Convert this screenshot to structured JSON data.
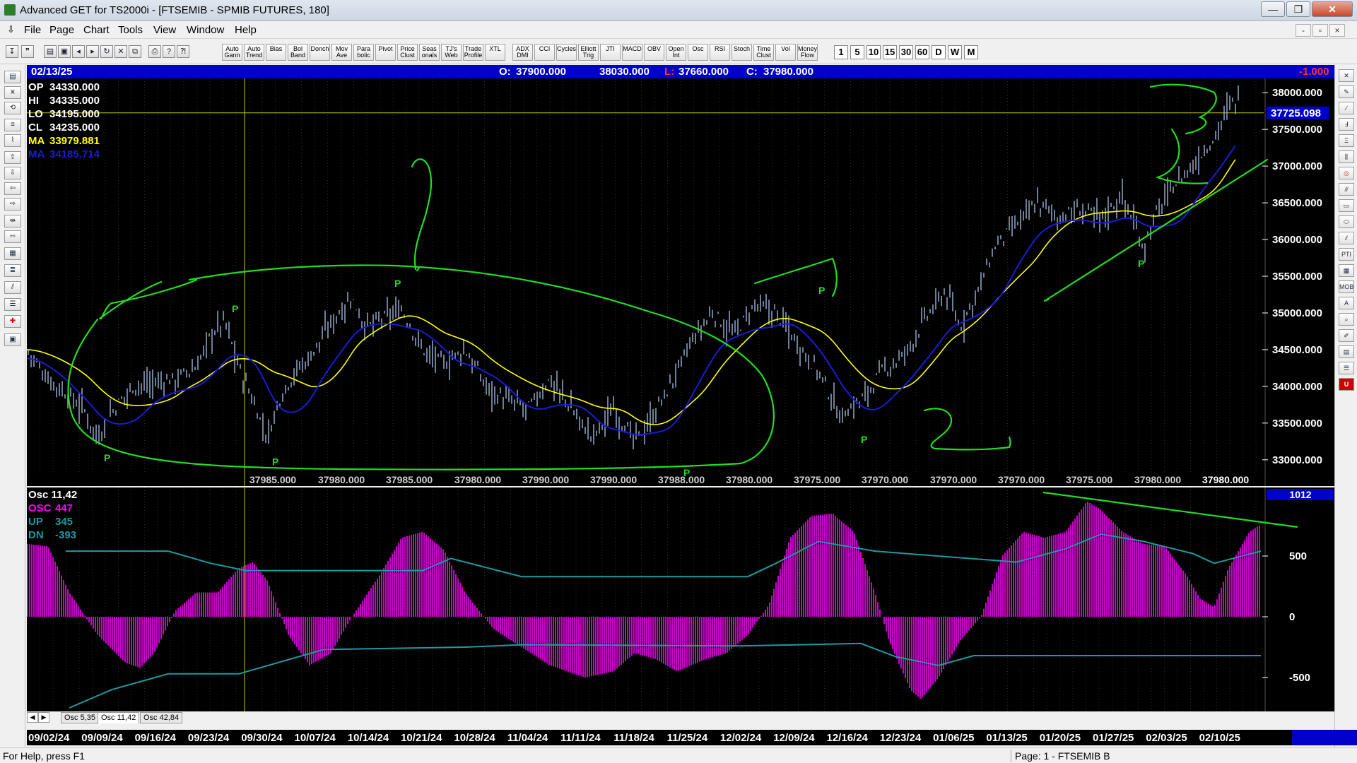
{
  "window": {
    "title": "Advanced GET for TS2000i - [FTSEMIB - SPMIB FUTURES, 180]",
    "minimize": "—",
    "maximize": "❐",
    "close": "✕"
  },
  "menu": {
    "items": [
      "File",
      "Page",
      "Chart",
      "Tools",
      "View",
      "Window",
      "Help"
    ],
    "mdi_min": "-",
    "mdi_restore": "▫",
    "mdi_close": "×"
  },
  "toolbar": {
    "study_buttons": [
      "Auto Gann",
      "Auto Trend",
      "Bias",
      "Bol Band",
      "Donch",
      "Mov Ave",
      "Para bolic",
      "Pivot",
      "Price Clust",
      "Seas onals",
      "TJ's Web",
      "Trade Profile",
      "XTL",
      "ADX DMI",
      "CCI",
      "Cycles",
      "Elliott Trig",
      "JTI",
      "MACD",
      "OBV",
      "Open Int",
      "Osc",
      "RSI",
      "Stoch",
      "Time Clust",
      "Vol",
      "Money Flow"
    ],
    "timeframes": [
      "1",
      "5",
      "10",
      "15",
      "30",
      "60",
      "D",
      "W",
      "M"
    ],
    "icons": [
      "pin-icon",
      "quote-icon",
      "open-icon",
      "save-icon",
      "back-icon",
      "forward-icon",
      "refresh-icon",
      "cancel-icon",
      "copy-icon",
      "print-icon",
      "help-icon",
      "whats-this-icon"
    ]
  },
  "header": {
    "date": "02/13/25",
    "open_label": "O:",
    "open": "37900.000",
    "high": "38030.000",
    "low_label": "L:",
    "low": "37660.000",
    "close_label": "C:",
    "close": "37980.000",
    "change": "-1.000"
  },
  "stats": {
    "op_label": "OP",
    "op": "34330.000",
    "hi_label": "HI",
    "hi": "34335.000",
    "lo_label": "LO",
    "lo": "34195.000",
    "cl_label": "CL",
    "cl": "34235.000",
    "ma1_label": "MA",
    "ma1": "33979.881",
    "ma2_label": "MA",
    "ma2": "34185.714"
  },
  "price_axis": {
    "ticks": [
      "38000.000",
      "37500.000",
      "37000.000",
      "36500.000",
      "36000.000",
      "35500.000",
      "35000.000",
      "34500.000",
      "34000.000",
      "33500.000",
      "33000.000"
    ],
    "cursor_price": "37725.098"
  },
  "bottom_price_labels": [
    "37985.000",
    "37980.000",
    "37985.000",
    "37980.000",
    "37990.000",
    "37990.000",
    "37988.000",
    "37980.000",
    "37975.000",
    "37970.000",
    "37970.000",
    "37970.000",
    "37975.000",
    "37980.000",
    "37980.000"
  ],
  "pivot_marker": "P",
  "oscillator": {
    "title": "Osc 11,42",
    "osc_label": "OSC",
    "osc": "447",
    "up_label": "UP",
    "up": "345",
    "dn_label": "DN",
    "dn": "-393",
    "axis_value": "1012",
    "ticks": [
      "500",
      "0",
      "-500"
    ]
  },
  "tabs": [
    "Osc 5,35",
    "Osc 11,42",
    "Osc 42,84"
  ],
  "dates": [
    "09/02/24",
    "09/09/24",
    "09/16/24",
    "09/23/24",
    "09/30/24",
    "10/07/24",
    "10/14/24",
    "10/21/24",
    "10/28/24",
    "11/04/24",
    "11/11/24",
    "11/18/24",
    "11/25/24",
    "12/02/24",
    "12/09/24",
    "12/16/24",
    "12/23/24",
    "01/06/25",
    "01/13/25",
    "01/20/25",
    "01/27/25",
    "02/03/25",
    "02/10/25"
  ],
  "status": {
    "help": "For Help, press F1",
    "page": "Page: 1 - FTSEMIB B"
  },
  "colors": {
    "background": "#000000",
    "header_blue": "#0000cc",
    "price_bars": "#a9c2e6",
    "ma_yellow": "#ffff00",
    "ma_blue": "#1b1bd6",
    "annotation_green": "#22dd22",
    "osc_magenta": "#ff00ff",
    "osc_band": "#1e9aa0"
  }
}
